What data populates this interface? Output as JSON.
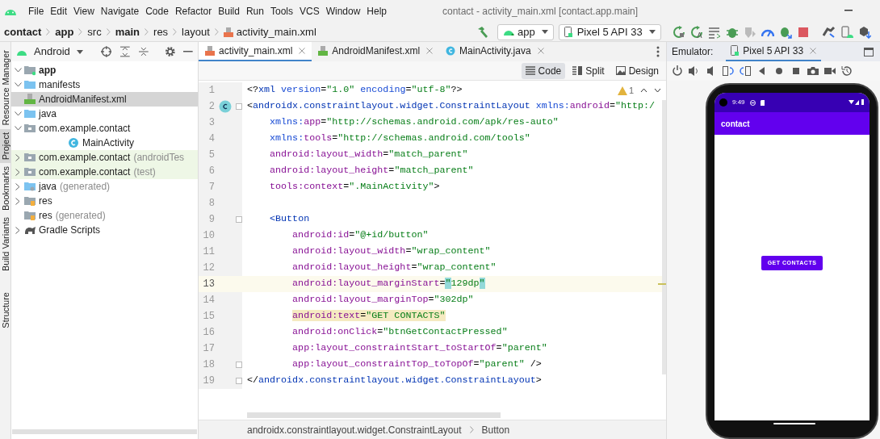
{
  "menu": [
    "File",
    "Edit",
    "View",
    "Navigate",
    "Code",
    "Refactor",
    "Build",
    "Run",
    "Tools",
    "VCS",
    "Window",
    "Help"
  ],
  "window_title": "contact - activity_main.xml [contact.app.main]",
  "breadcrumb": [
    {
      "label": "contact",
      "bold": true,
      "kind": "folder"
    },
    {
      "label": "app",
      "bold": true,
      "kind": "folder"
    },
    {
      "label": "src",
      "bold": false,
      "kind": "folder"
    },
    {
      "label": "main",
      "bold": true,
      "kind": "folder"
    },
    {
      "label": "res",
      "bold": false,
      "kind": "folder"
    },
    {
      "label": "layout",
      "bold": false,
      "kind": "folder"
    },
    {
      "label": "activity_main.xml",
      "bold": false,
      "kind": "file"
    }
  ],
  "run_toolbar": {
    "module": "app",
    "device": "Pixel 5 API 33"
  },
  "side_tools": [
    {
      "label": "Resource Manager",
      "selected": false
    },
    {
      "label": "Project",
      "selected": true
    },
    {
      "label": "Bookmarks",
      "selected": false
    },
    {
      "label": "Build Variants",
      "selected": false
    },
    {
      "label": "Structure",
      "selected": false
    }
  ],
  "project": {
    "view": "Android",
    "tree": [
      {
        "label": "app",
        "kind": "module",
        "expanded": true,
        "selected": false,
        "test": false,
        "children": [
          {
            "label": "manifests",
            "kind": "folder",
            "expanded": true,
            "selected": false,
            "test": false,
            "children": [
              {
                "label": "AndroidManifest.xml",
                "kind": "manifest",
                "selected": true,
                "test": false
              }
            ]
          },
          {
            "label": "java",
            "kind": "folder",
            "expanded": true,
            "selected": false,
            "test": false,
            "children": [
              {
                "label": "com.example.contact",
                "kind": "package",
                "expanded": true,
                "selected": false,
                "test": false,
                "children": [
                  {
                    "label": "MainActivity",
                    "kind": "class",
                    "selected": false,
                    "test": false
                  }
                ]
              },
              {
                "label": "com.example.contact",
                "note": "(androidTes",
                "kind": "package",
                "expanded": false,
                "selected": false,
                "test": true
              },
              {
                "label": "com.example.contact",
                "note": "(test)",
                "kind": "package",
                "expanded": false,
                "selected": false,
                "test": true
              }
            ]
          },
          {
            "label": "java",
            "note": "(generated)",
            "kind": "generated",
            "expanded": false,
            "selected": false,
            "test": false
          },
          {
            "label": "res",
            "kind": "res",
            "expanded": false,
            "selected": false,
            "test": false
          },
          {
            "label": "res",
            "note": "(generated)",
            "kind": "res",
            "selected": false,
            "test": false
          }
        ]
      },
      {
        "label": "Gradle Scripts",
        "kind": "gradle",
        "expanded": false,
        "selected": false,
        "test": false
      }
    ]
  },
  "editor": {
    "tabs": [
      {
        "label": "activity_main.xml",
        "kind": "xml",
        "selected": true
      },
      {
        "label": "AndroidManifest.xml",
        "kind": "manifest",
        "selected": false
      },
      {
        "label": "MainActivity.java",
        "kind": "class",
        "selected": false
      }
    ],
    "views": [
      {
        "label": "Code",
        "selected": true
      },
      {
        "label": "Split",
        "selected": false
      },
      {
        "label": "Design",
        "selected": false
      }
    ],
    "warnings": "1",
    "lines": [
      {
        "n": "1",
        "current": false,
        "fold": false,
        "class_marker": false,
        "tokens": [
          {
            "text": "<?",
            "kind": "p"
          },
          {
            "text": "xml ",
            "kind": "tag"
          },
          {
            "text": "version",
            "kind": "attr"
          },
          {
            "text": "=",
            "kind": "p"
          },
          {
            "text": "\"1.0\" ",
            "kind": "val"
          },
          {
            "text": "encoding",
            "kind": "attr"
          },
          {
            "text": "=",
            "kind": "p"
          },
          {
            "text": "\"utf-8\"",
            "kind": "val"
          },
          {
            "text": "?>",
            "kind": "p"
          }
        ]
      },
      {
        "n": "2",
        "current": false,
        "fold": true,
        "class_marker": true,
        "tokens": [
          {
            "text": "<",
            "kind": "p"
          },
          {
            "text": "androidx.constraintlayout.widget.ConstraintLayout ",
            "kind": "tag"
          },
          {
            "text": "xmlns:",
            "kind": "attr"
          },
          {
            "text": "android",
            "kind": "ns"
          },
          {
            "text": "=",
            "kind": "p"
          },
          {
            "text": "\"http:/",
            "kind": "val"
          }
        ]
      },
      {
        "n": "3",
        "current": false,
        "fold": false,
        "class_marker": false,
        "tokens": [
          {
            "text": "    xmlns:",
            "kind": "attr"
          },
          {
            "text": "app",
            "kind": "ns"
          },
          {
            "text": "=",
            "kind": "p"
          },
          {
            "text": "\"http://schemas.android.com/apk/res-auto\"",
            "kind": "val"
          }
        ]
      },
      {
        "n": "4",
        "current": false,
        "fold": false,
        "class_marker": false,
        "tokens": [
          {
            "text": "    xmlns:",
            "kind": "attr"
          },
          {
            "text": "tools",
            "kind": "ns"
          },
          {
            "text": "=",
            "kind": "p"
          },
          {
            "text": "\"http://schemas.android.com/tools\"",
            "kind": "val"
          }
        ]
      },
      {
        "n": "5",
        "current": false,
        "fold": false,
        "class_marker": false,
        "tokens": [
          {
            "text": "    android:layout_width",
            "kind": "ns"
          },
          {
            "text": "=",
            "kind": "p"
          },
          {
            "text": "\"match_parent\"",
            "kind": "val"
          }
        ]
      },
      {
        "n": "6",
        "current": false,
        "fold": false,
        "class_marker": false,
        "tokens": [
          {
            "text": "    android:layout_height",
            "kind": "ns"
          },
          {
            "text": "=",
            "kind": "p"
          },
          {
            "text": "\"match_parent\"",
            "kind": "val"
          }
        ]
      },
      {
        "n": "7",
        "current": false,
        "fold": false,
        "class_marker": false,
        "tokens": [
          {
            "text": "    tools:context",
            "kind": "ns"
          },
          {
            "text": "=",
            "kind": "p"
          },
          {
            "text": "\".MainActivity\"",
            "kind": "val"
          },
          {
            "text": ">",
            "kind": "p"
          }
        ]
      },
      {
        "n": "8",
        "current": false,
        "fold": false,
        "class_marker": false
      },
      {
        "n": "9",
        "current": false,
        "fold": true,
        "class_marker": false,
        "tokens": [
          {
            "text": "    <Button",
            "kind": "tag"
          }
        ]
      },
      {
        "n": "10",
        "current": false,
        "fold": false,
        "class_marker": false,
        "tokens": [
          {
            "text": "        android:id",
            "kind": "ns"
          },
          {
            "text": "=",
            "kind": "p"
          },
          {
            "text": "\"@+id/button\"",
            "kind": "val"
          }
        ]
      },
      {
        "n": "11",
        "current": false,
        "fold": false,
        "class_marker": false,
        "tokens": [
          {
            "text": "        android:layout_width",
            "kind": "ns"
          },
          {
            "text": "=",
            "kind": "p"
          },
          {
            "text": "\"wrap_content\"",
            "kind": "val"
          }
        ]
      },
      {
        "n": "12",
        "current": false,
        "fold": false,
        "class_marker": false,
        "tokens": [
          {
            "text": "        android:layout_height",
            "kind": "ns"
          },
          {
            "text": "=",
            "kind": "p"
          },
          {
            "text": "\"wrap_content\"",
            "kind": "val"
          }
        ]
      },
      {
        "n": "13",
        "current": true,
        "fold": false,
        "class_marker": false,
        "tokens": [
          {
            "text": "        android:layout_marginStart",
            "kind": "ns"
          },
          {
            "text": "=",
            "kind": "p"
          },
          {
            "text": "\"",
            "kind": "val_match"
          },
          {
            "text": "129dp",
            "kind": "val"
          },
          {
            "text": "\"",
            "kind": "val_match"
          }
        ]
      },
      {
        "n": "14",
        "current": false,
        "fold": false,
        "class_marker": false,
        "tokens": [
          {
            "text": "        android:layout_marginTop",
            "kind": "ns"
          },
          {
            "text": "=",
            "kind": "p"
          },
          {
            "text": "\"302dp\"",
            "kind": "val"
          }
        ]
      },
      {
        "n": "15",
        "current": false,
        "fold": false,
        "class_marker": false,
        "tokens": [
          {
            "text": "        android:text",
            "kind": "ns_usage"
          },
          {
            "text": "=",
            "kind": "p_usage"
          },
          {
            "text": "\"GET CONTACTS\"",
            "kind": "val_usage"
          }
        ]
      },
      {
        "n": "16",
        "current": false,
        "fold": false,
        "class_marker": false,
        "tokens": [
          {
            "text": "        android:onClick",
            "kind": "ns"
          },
          {
            "text": "=",
            "kind": "p"
          },
          {
            "text": "\"btnGetContactPressed\"",
            "kind": "val"
          }
        ]
      },
      {
        "n": "17",
        "current": false,
        "fold": false,
        "class_marker": false,
        "tokens": [
          {
            "text": "        app:layout_constraintStart_toStartOf",
            "kind": "ns"
          },
          {
            "text": "=",
            "kind": "p"
          },
          {
            "text": "\"parent\"",
            "kind": "val"
          }
        ]
      },
      {
        "n": "18",
        "current": false,
        "fold": true,
        "class_marker": false,
        "tokens": [
          {
            "text": "        app:layout_constraintTop_toTopOf",
            "kind": "ns"
          },
          {
            "text": "=",
            "kind": "p"
          },
          {
            "text": "\"parent\" ",
            "kind": "val"
          },
          {
            "text": "/>",
            "kind": "p"
          }
        ]
      },
      {
        "n": "19",
        "current": false,
        "fold": true,
        "class_marker": false,
        "tokens": [
          {
            "text": "</",
            "kind": "p"
          },
          {
            "text": "androidx.constraintlayout.widget.ConstraintLayout",
            "kind": "tag"
          },
          {
            "text": ">",
            "kind": "p"
          }
        ]
      }
    ],
    "path": [
      "androidx.constraintlayout.widget.ConstraintLayout",
      "Button"
    ]
  },
  "emulator": {
    "label": "Emulator:",
    "tab": "Pixel 5 API 33",
    "phone": {
      "time": "9:49",
      "app_title": "contact",
      "button": "GET CONTACTS"
    }
  }
}
